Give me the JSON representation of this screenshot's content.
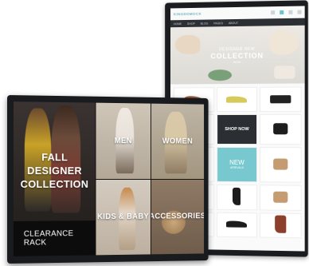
{
  "portrait_display": {
    "logo": "KINGDOMOCK",
    "nav_items": [
      "HOME",
      "SHOP",
      "BLOG",
      "PAGES",
      "ABOUT"
    ],
    "hero": {
      "line1": "DESIGNER NEW",
      "line2": "COLLECTION",
      "line3": "NOW"
    },
    "promo_shop_now": "SHOP NOW",
    "promo_new": "NEW",
    "promo_new_sub": "ARRIVALS",
    "accent_color": "#78c9cf"
  },
  "landscape_display": {
    "tiles": {
      "fall": "FALL DESIGNER COLLECTION",
      "men": "MEN",
      "women": "WOMEN",
      "kids": "KIDS & BABY",
      "accessories": "ACCESSORIES",
      "clearance": "CLEARANCE RACK"
    }
  }
}
